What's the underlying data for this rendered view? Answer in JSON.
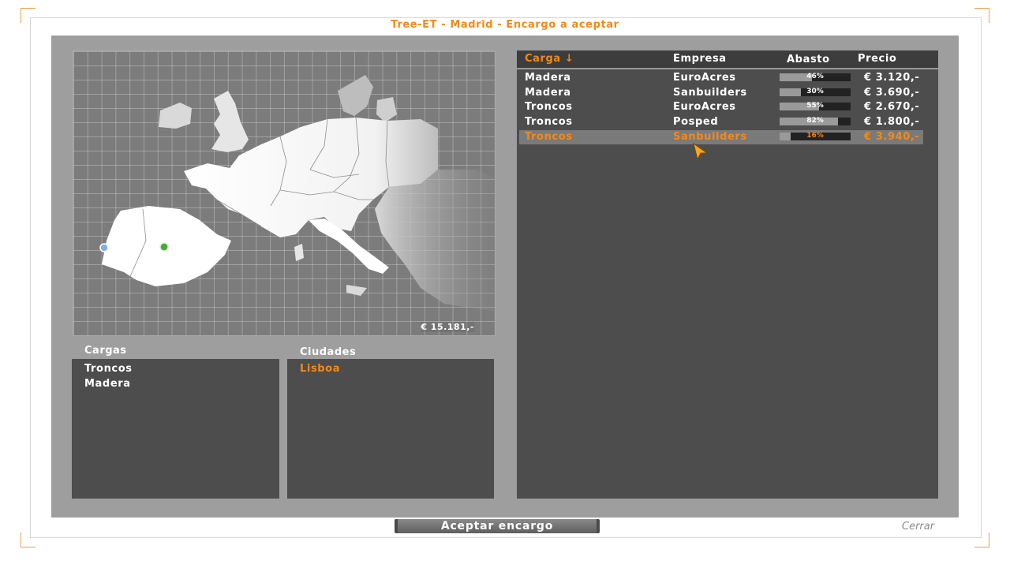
{
  "window": {
    "title": "Tree-ET - Madrid - Encargo a aceptar"
  },
  "map": {
    "total": "€ 15.181,-"
  },
  "cargas": {
    "label": "Cargas",
    "items": [
      "Troncos",
      "Madera"
    ]
  },
  "ciudades": {
    "label": "Ciudades",
    "items": [
      "Lisboa"
    ],
    "selected": "Lisboa"
  },
  "table": {
    "headers": {
      "carga": "Carga ↓",
      "empresa": "Empresa",
      "abasto": "Abasto",
      "precio": "Precio"
    },
    "sorted_column": "carga",
    "rows": [
      {
        "carga": "Madera",
        "empresa": "EuroAcres",
        "abasto": "46%",
        "abasto_value": 0.46,
        "precio": "€ 3.120,-"
      },
      {
        "carga": "Madera",
        "empresa": "Sanbuilders",
        "abasto": "30%",
        "abasto_value": 0.3,
        "precio": "€ 3.690,-"
      },
      {
        "carga": "Troncos",
        "empresa": "EuroAcres",
        "abasto": "55%",
        "abasto_value": 0.55,
        "precio": "€ 2.670,-"
      },
      {
        "carga": "Troncos",
        "empresa": "Posped",
        "abasto": "82%",
        "abasto_value": 0.82,
        "precio": "€ 1.800,-"
      },
      {
        "carga": "Troncos",
        "empresa": "Sanbuilders",
        "abasto": "16%",
        "abasto_value": 0.16,
        "precio": "€ 3.940,-"
      }
    ],
    "selected_row": 4
  },
  "footer": {
    "accept": "Aceptar encargo",
    "close": "Cerrar"
  },
  "colors": {
    "accent": "#f08a1c",
    "panel": "#4d4d4d",
    "background": "#9e9e9e"
  },
  "icons": {
    "sort": "arrow-down-icon",
    "cursor": "mouse-pointer-icon"
  }
}
